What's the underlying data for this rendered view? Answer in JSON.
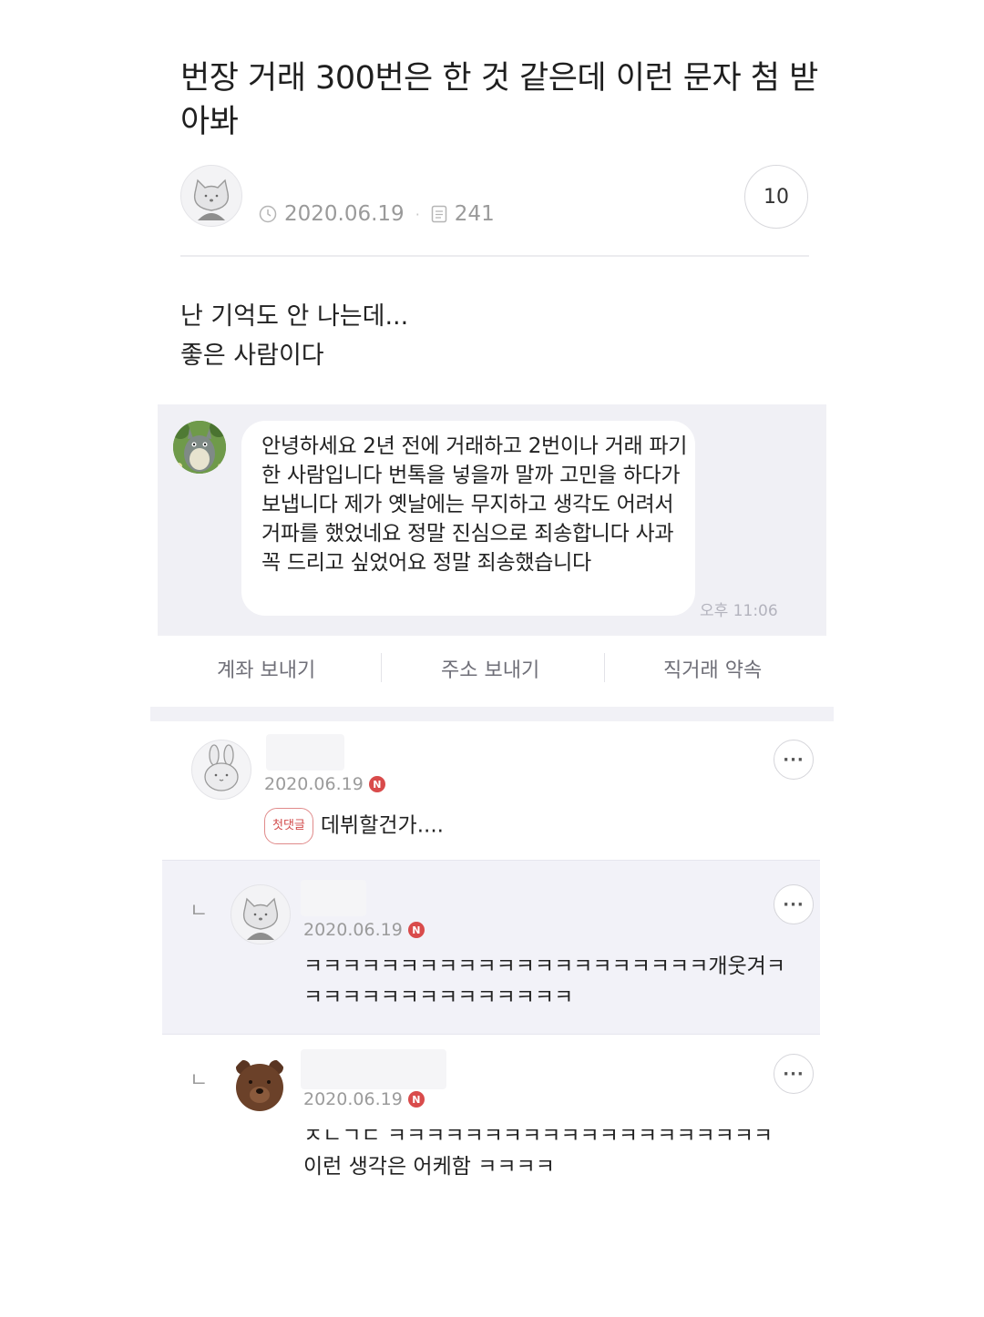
{
  "post": {
    "title": "번장 거래 300번은 한 것 같은데 이런 문자 첨 받아봐",
    "date": "2020.06.19",
    "views": "241",
    "comment_count": "10",
    "body_line1": "난 기억도 안 나는데...",
    "body_line2": "좋은 사람이다"
  },
  "chat": {
    "message": "안녕하세요 2년 전에 거래하고 2번이나 거래 파기한 사람입니다 번톡을 넣을까 말까 고민을 하다가 보냅니다 제가 옛날에는 무지하고 생각도 어려서 거파를 했었네요 정말 진심으로 죄송합니다 사과 꼭 드리고 싶었어요 정말 죄송했습니다",
    "time": "오후 11:06",
    "actions": [
      "계좌 보내기",
      "주소 보내기",
      "직거래 약속"
    ]
  },
  "comments": [
    {
      "date": "2020.06.19",
      "badge": "N",
      "tag": "첫댓글",
      "text": "데뷔할건가....",
      "more": "···"
    },
    {
      "reply_mark": "ㄴ",
      "date": "2020.06.19",
      "badge": "N",
      "text": "ㅋㅋㅋㅋㅋㅋㅋㅋㅋㅋㅋㅋㅋㅋㅋㅋㅋㅋㅋㅋㅋ개웃겨ㅋㅋㅋㅋㅋㅋㅋㅋㅋㅋㅋㅋㅋㅋㅋ",
      "more": "···"
    },
    {
      "reply_mark": "ㄴ",
      "date": "2020.06.19",
      "badge": "N",
      "text": "ㅈㄴㄱㄷ ㅋㅋㅋㅋㅋㅋㅋㅋㅋㅋㅋㅋㅋㅋㅋㅋㅋㅋㅋㅋ 이런 생각은 어케함 ㅋㅋㅋㅋ",
      "more": "···"
    }
  ],
  "icons": [
    "clock-icon",
    "document-icon",
    "more-icon",
    "cat-avatar",
    "totoro-avatar",
    "bunny-avatar",
    "bear-avatar"
  ]
}
